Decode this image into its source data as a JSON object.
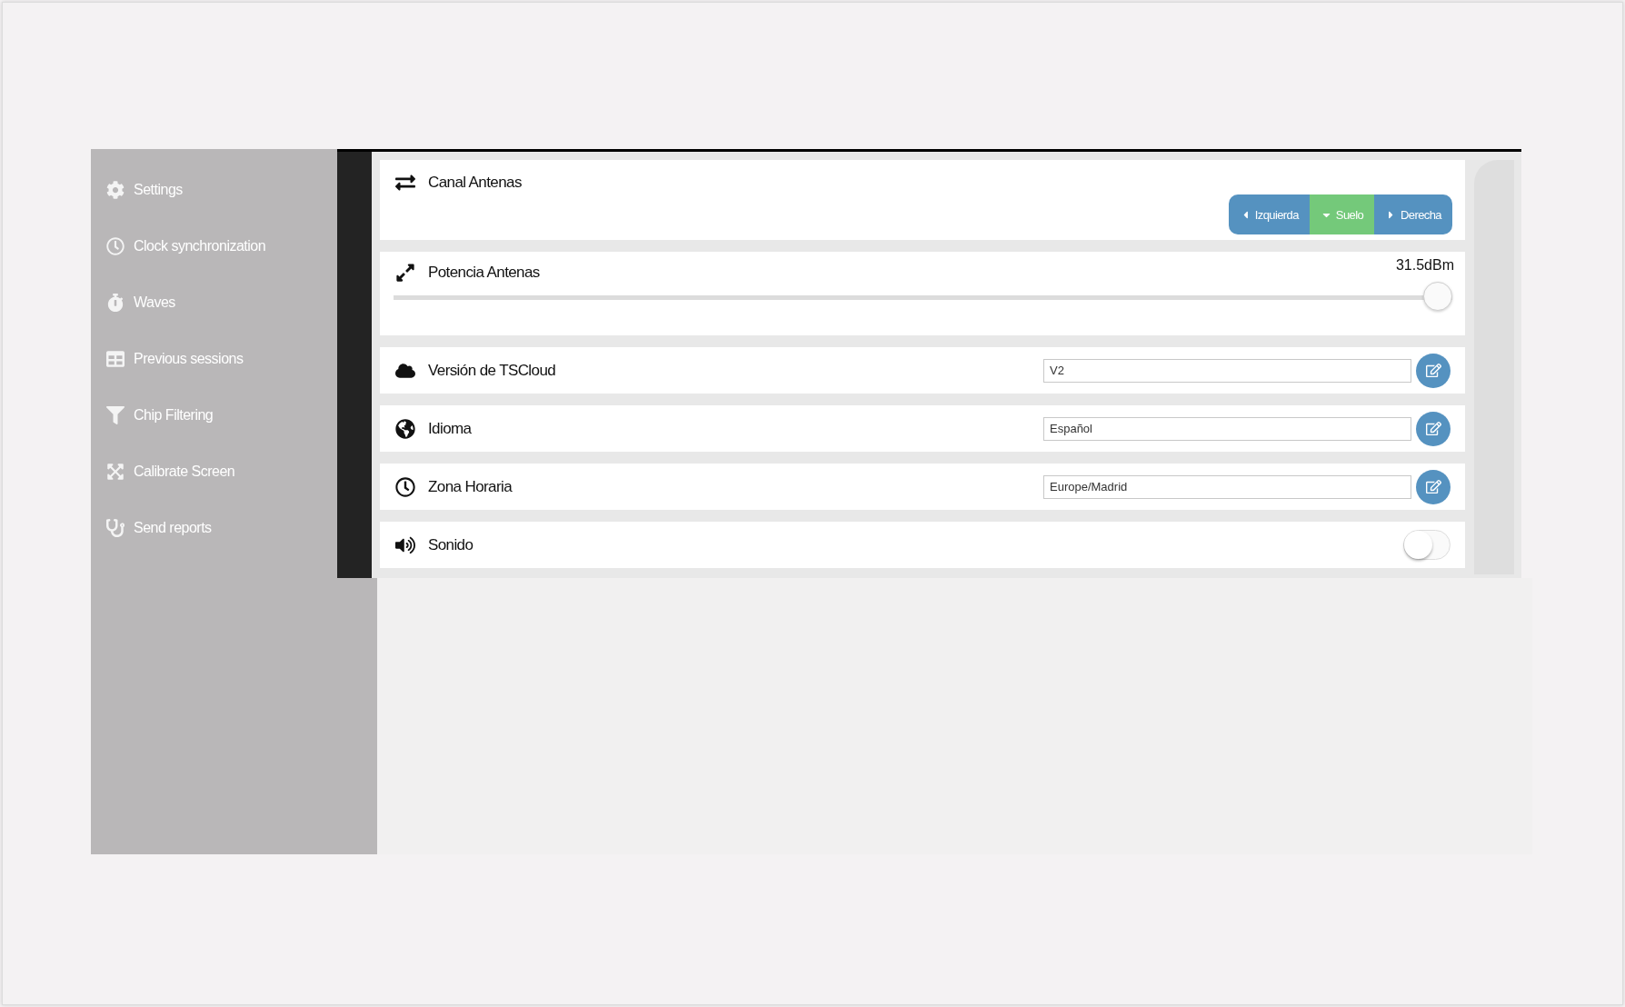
{
  "sidebar": {
    "items": [
      {
        "label": "Settings"
      },
      {
        "label": "Clock synchronization"
      },
      {
        "label": "Waves"
      },
      {
        "label": "Previous sessions"
      },
      {
        "label": "Chip Filtering"
      },
      {
        "label": "Calibrate Screen"
      },
      {
        "label": "Send reports"
      }
    ]
  },
  "settings": [
    {
      "kind": "segments",
      "title": "Canal Antenas",
      "options": [
        {
          "label": "Izquierda",
          "selected": false
        },
        {
          "label": "Suelo",
          "selected": true
        },
        {
          "label": "Derecha",
          "selected": false
        }
      ]
    },
    {
      "kind": "slider",
      "title": "Potencia Antenas",
      "reading": "31.5dBm",
      "level": 1
    },
    {
      "kind": "field",
      "title": "Versión de TSCloud",
      "value": "V2"
    },
    {
      "kind": "field",
      "title": "Idioma",
      "value": "Español"
    },
    {
      "kind": "field",
      "title": "Zona Horaria",
      "value": "Europe/Madrid"
    },
    {
      "kind": "toggle",
      "title": "Sonido",
      "on": false
    }
  ]
}
